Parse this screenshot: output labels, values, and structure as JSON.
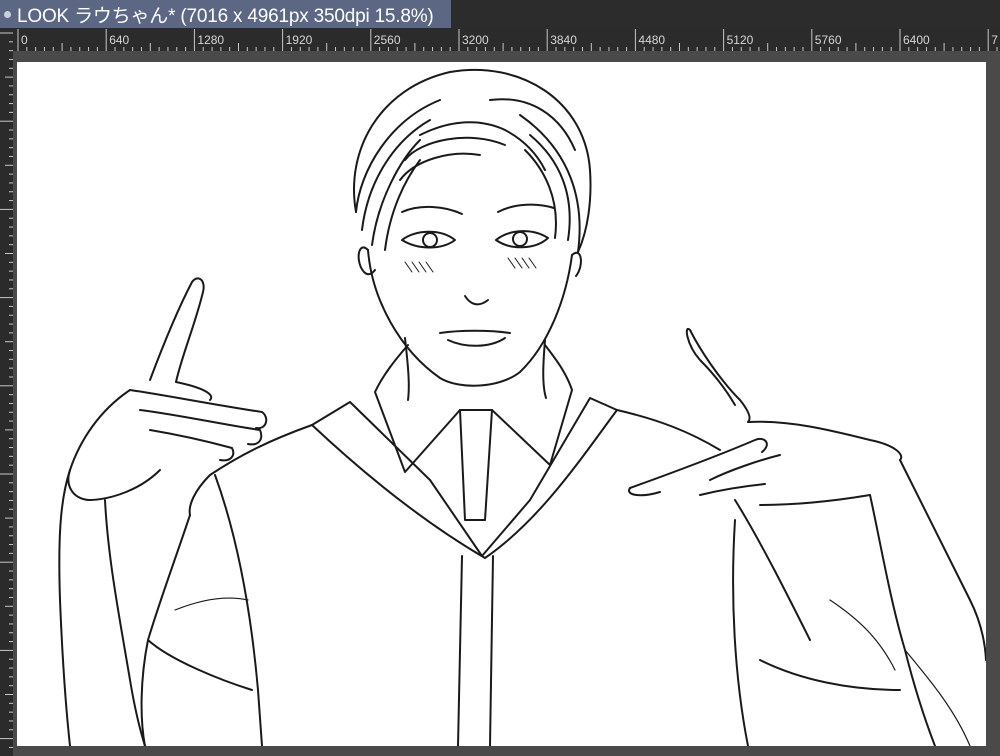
{
  "document": {
    "tab_title": "LOOK ラウちゃん* (7016 x 4961px 350dpi 15.8%)"
  },
  "ruler": {
    "labels": [
      "0",
      "640",
      "1280",
      "1920",
      "2560",
      "3200",
      "3840",
      "4480",
      "5120",
      "5760",
      "6400",
      "7"
    ]
  },
  "icons": {
    "tab_dot": "unsaved-dot-icon"
  },
  "colors": {
    "tab_active": "#5c6784",
    "ruler_bg": "#2b2b2b",
    "canvas_bg": "#ffffff",
    "workspace_bg": "#4a4a4a",
    "line_art": "#1a1a1a"
  }
}
